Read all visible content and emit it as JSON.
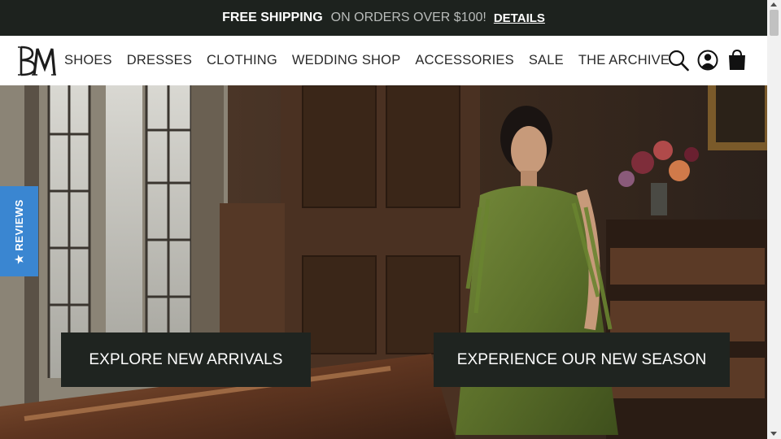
{
  "promo": {
    "bold_text": "FREE SHIPPING",
    "light_text": "ON ORDERS OVER $100!",
    "link_text": "DETAILS"
  },
  "header": {
    "logo_letters": "BM",
    "nav": [
      "SHOES",
      "DRESSES",
      "CLOTHING",
      "WEDDING SHOP",
      "ACCESSORIES",
      "SALE",
      "THE ARCHIVE"
    ],
    "icons": [
      "search-icon",
      "account-icon",
      "shopping-bag-icon"
    ]
  },
  "hero": {
    "cta_left": "EXPLORE NEW ARRIVALS",
    "cta_right": "EXPERIENCE OUR NEW SEASON"
  },
  "reviews_tab": {
    "label": "★ REVIEWS"
  },
  "colors": {
    "bar": "#1d221e",
    "cta": "#1f2420",
    "reviews": "#3a86d1"
  }
}
